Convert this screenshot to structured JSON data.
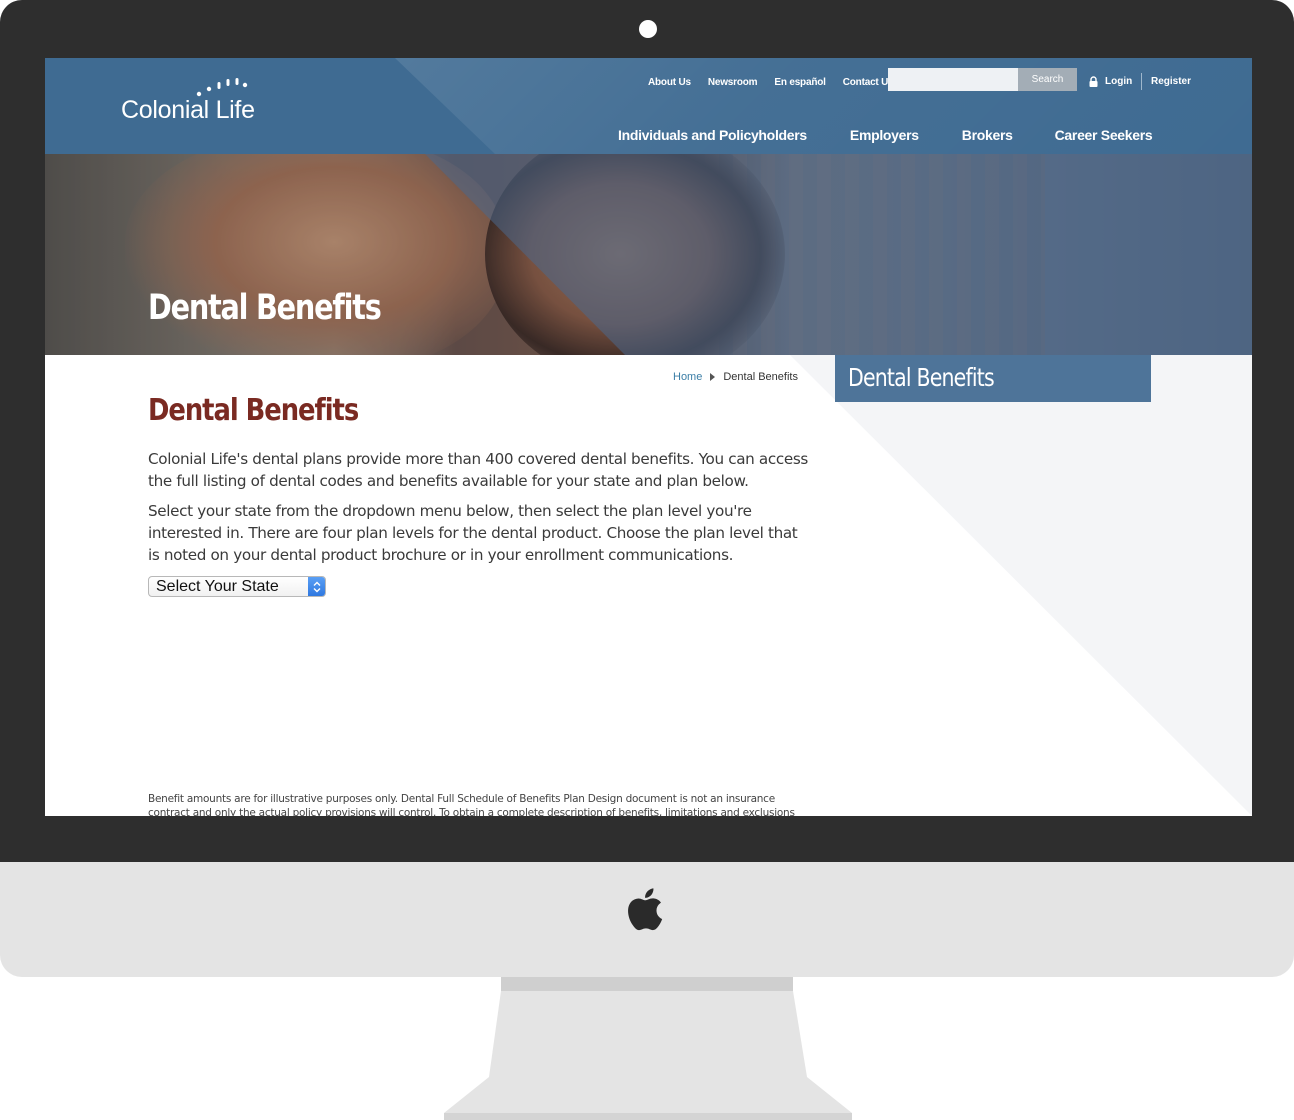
{
  "brand": {
    "name": "Colonial Life"
  },
  "utility_nav": {
    "links": [
      "About Us",
      "Newsroom",
      "En español",
      "Contact Us"
    ],
    "search_placeholder": "",
    "search_button": "Search",
    "login": "Login",
    "register": "Register"
  },
  "main_nav": {
    "items": [
      "Individuals and Policyholders",
      "Employers",
      "Brokers",
      "Career Seekers"
    ]
  },
  "hero": {
    "title": "Dental Benefits"
  },
  "breadcrumb": {
    "home": "Home",
    "current": "Dental Benefits"
  },
  "main": {
    "heading": "Dental Benefits",
    "paragraph_1": "Colonial Life's dental plans provide more than 400 covered dental benefits. You can access the full listing of dental codes and benefits available for your state and plan below.",
    "paragraph_2": "Select your state from the dropdown menu below, then select the plan level you're interested in. There are four plan levels for the dental product. Choose the plan level that is noted on your dental product brochure or in your enrollment communications.",
    "state_select": "Select Your State",
    "disclaimer": "Benefit amounts are for illustrative purposes only. Dental Full Schedule of Benefits Plan Design document is not an insurance contract and only the actual policy provisions will control. To obtain a complete description of benefits, limitations and exclusions"
  },
  "sidebar": {
    "title": "Dental Benefits"
  },
  "colors": {
    "header": "#3f6b92",
    "heading": "#7a2a22",
    "sidebar": "#4e7499",
    "link": "#3b7ea6"
  }
}
